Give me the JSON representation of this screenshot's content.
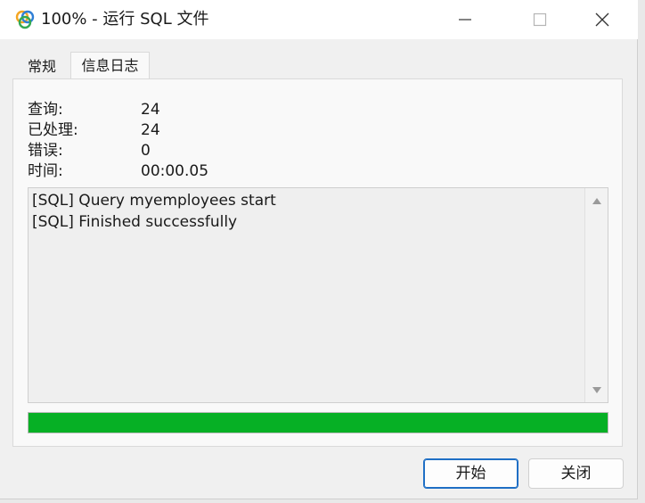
{
  "window": {
    "title": "100% - 运行 SQL 文件"
  },
  "tabs": [
    {
      "label": "常规",
      "active": false
    },
    {
      "label": "信息日志",
      "active": true
    }
  ],
  "stats": [
    {
      "label": "查询:",
      "value": "24"
    },
    {
      "label": "已处理:",
      "value": "24"
    },
    {
      "label": "错误:",
      "value": "0"
    },
    {
      "label": "时间:",
      "value": "00:00.05"
    }
  ],
  "log": [
    "[SQL] Query myemployees start",
    "[SQL] Finished successfully"
  ],
  "progress": {
    "percent": 100,
    "color": "#06b025"
  },
  "buttons": {
    "start": "开始",
    "close": "关闭"
  },
  "icons": {
    "app": "navicat-app-icon",
    "minimize": "minimize-icon",
    "maximize": "maximize-icon",
    "close": "close-icon",
    "scroll_up": "arrow-up-icon",
    "scroll_down": "arrow-down-icon"
  }
}
